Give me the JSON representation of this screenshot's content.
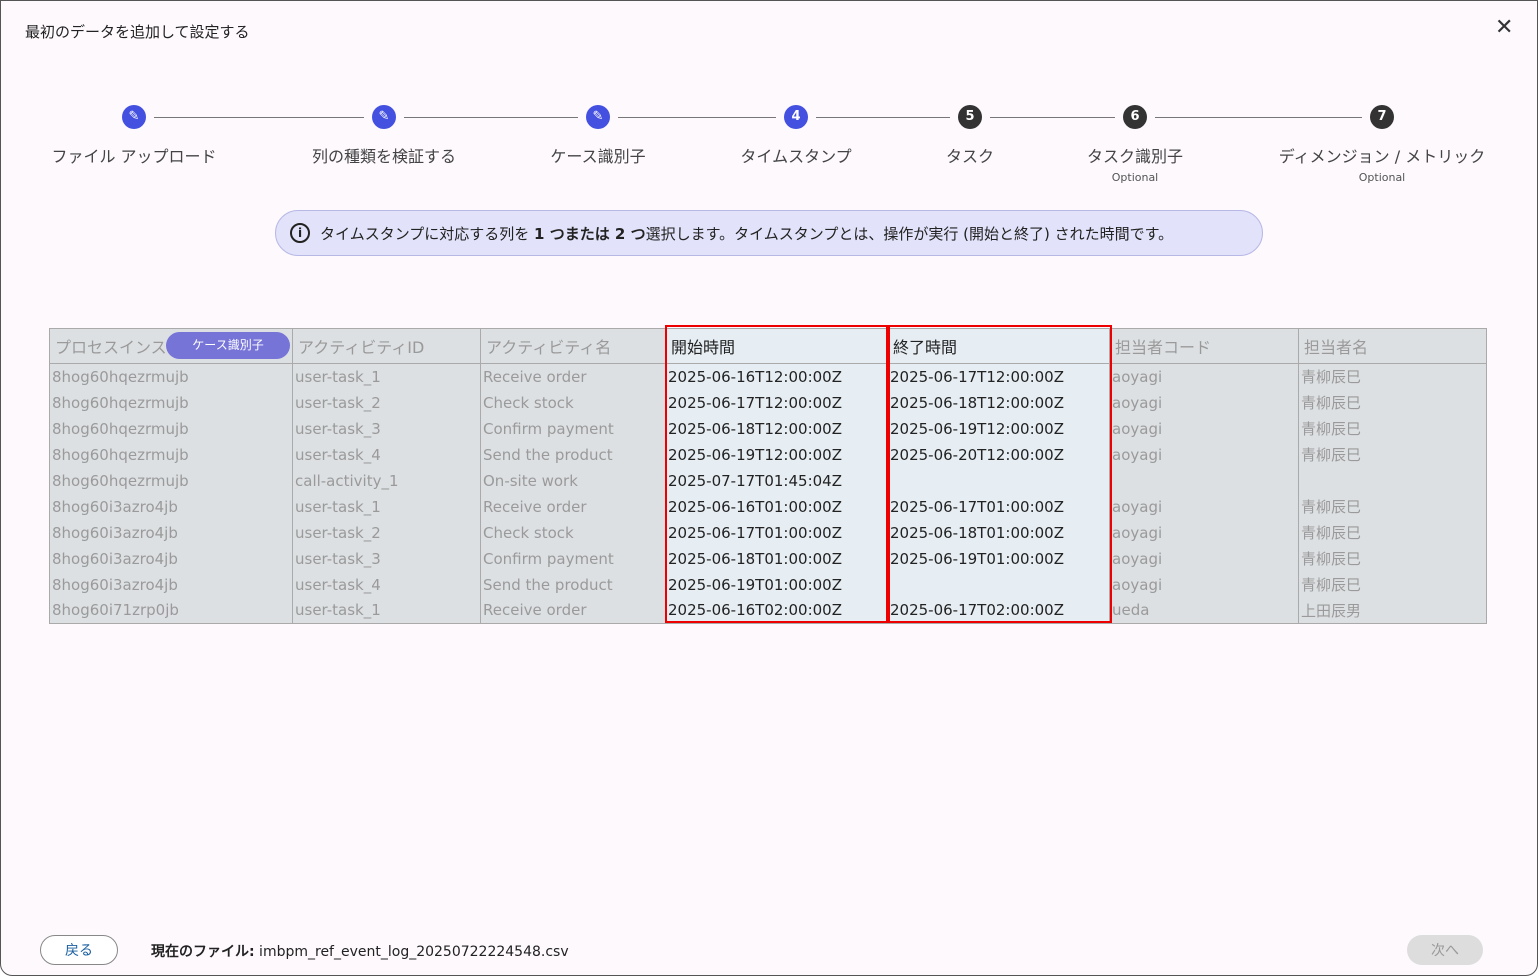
{
  "title": "最初のデータを追加して設定する",
  "steps": [
    {
      "num": "1",
      "label": "ファイル アップロード",
      "state": "done",
      "optional": ""
    },
    {
      "num": "2",
      "label": "列の種類を検証する",
      "state": "done",
      "optional": ""
    },
    {
      "num": "3",
      "label": "ケース識別子",
      "state": "done",
      "optional": ""
    },
    {
      "num": "4",
      "label": "タイムスタンプ",
      "state": "cur",
      "optional": ""
    },
    {
      "num": "5",
      "label": "タスク",
      "state": "todo",
      "optional": ""
    },
    {
      "num": "6",
      "label": "タスク識別子",
      "state": "todo",
      "optional": "Optional"
    },
    {
      "num": "7",
      "label": "ディメンジョン / メトリック",
      "state": "todo",
      "optional": "Optional"
    }
  ],
  "info": {
    "pre": "タイムスタンプに対応する列を ",
    "bold": "1 つまたは 2 つ",
    "post": "選択します。タイムスタンプとは、操作が実行 (開始と終了) された時間です。"
  },
  "table": {
    "badge": "ケース識別子",
    "columns": [
      "プロセスインス",
      "アクティビティID",
      "アクティビティ名",
      "開始時間",
      "終了時間",
      "担当者コード",
      "担当者名"
    ],
    "selected": [
      3,
      4
    ],
    "rows": [
      [
        "8hog60hqezrmujb",
        "user-task_1",
        "Receive order",
        "2025-06-16T12:00:00Z",
        "2025-06-17T12:00:00Z",
        "aoyagi",
        "青柳辰巳"
      ],
      [
        "8hog60hqezrmujb",
        "user-task_2",
        "Check stock",
        "2025-06-17T12:00:00Z",
        "2025-06-18T12:00:00Z",
        "aoyagi",
        "青柳辰巳"
      ],
      [
        "8hog60hqezrmujb",
        "user-task_3",
        "Confirm payment",
        "2025-06-18T12:00:00Z",
        "2025-06-19T12:00:00Z",
        "aoyagi",
        "青柳辰巳"
      ],
      [
        "8hog60hqezrmujb",
        "user-task_4",
        "Send the product",
        "2025-06-19T12:00:00Z",
        "2025-06-20T12:00:00Z",
        "aoyagi",
        "青柳辰巳"
      ],
      [
        "8hog60hqezrmujb",
        "call-activity_1",
        "On-site work",
        "2025-07-17T01:45:04Z",
        "",
        "",
        ""
      ],
      [
        "8hog60i3azro4jb",
        "user-task_1",
        "Receive order",
        "2025-06-16T01:00:00Z",
        "2025-06-17T01:00:00Z",
        "aoyagi",
        "青柳辰巳"
      ],
      [
        "8hog60i3azro4jb",
        "user-task_2",
        "Check stock",
        "2025-06-17T01:00:00Z",
        "2025-06-18T01:00:00Z",
        "aoyagi",
        "青柳辰巳"
      ],
      [
        "8hog60i3azro4jb",
        "user-task_3",
        "Confirm payment",
        "2025-06-18T01:00:00Z",
        "2025-06-19T01:00:00Z",
        "aoyagi",
        "青柳辰巳"
      ],
      [
        "8hog60i3azro4jb",
        "user-task_4",
        "Send the product",
        "2025-06-19T01:00:00Z",
        "",
        "aoyagi",
        "青柳辰巳"
      ],
      [
        "8hog60i71zrp0jb",
        "user-task_1",
        "Receive order",
        "2025-06-16T02:00:00Z",
        "2025-06-17T02:00:00Z",
        "ueda",
        "上田辰男"
      ]
    ]
  },
  "footer": {
    "back": "戻る",
    "file_label": "現在のファイル:",
    "file_name": " imbpm_ref_event_log_20250722224548.csv",
    "next": "次へ"
  }
}
